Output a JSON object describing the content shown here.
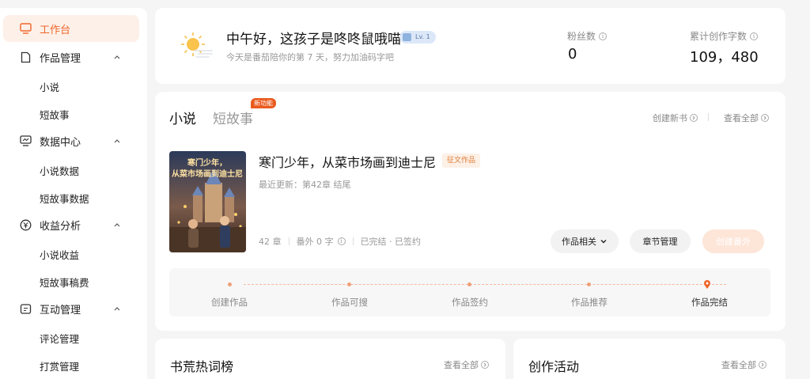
{
  "sidebar": {
    "workbench": "工作台",
    "groups": [
      {
        "label": "作品管理",
        "items": [
          "小说",
          "短故事"
        ]
      },
      {
        "label": "数据中心",
        "items": [
          "小说数据",
          "短故事数据"
        ]
      },
      {
        "label": "收益分析",
        "items": [
          "小说收益",
          "短故事稿费"
        ]
      },
      {
        "label": "互动管理",
        "items": [
          "评论管理",
          "打赏管理"
        ]
      }
    ]
  },
  "greeting": {
    "title": "中午好，这孩子是咚咚鼠哦喵",
    "level": "Lv. 1",
    "subtitle": "今天是番茄陪你的第 7 天，努力加油码字吧",
    "fans_label": "粉丝数",
    "fans_value": "0",
    "words_label": "累计创作字数",
    "words_value": "109，480"
  },
  "works": {
    "tabs": [
      "小说",
      "短故事"
    ],
    "new_badge": "新功能",
    "create_link": "创建新书",
    "view_all": "查看全部",
    "book": {
      "cover_text_line1": "寒门少年，",
      "cover_text_line2": "从菜市场画到迪士尼",
      "title": "寒门少年，从菜市场画到迪士尼",
      "tag": "征文作品",
      "update": "最近更新：第42章 结尾",
      "chapters": "42 章",
      "extra": "番外 0 字",
      "status": "已完结 · 已签约"
    },
    "buttons": {
      "related": "作品相关",
      "chapters": "章节管理",
      "create_extra": "创建番外"
    },
    "steps": [
      "创建作品",
      "作品可搜",
      "作品签约",
      "作品推荐",
      "作品完结"
    ],
    "accent": "#f0652a"
  },
  "hot": {
    "title": "书荒热词榜",
    "view_all": "查看全部"
  },
  "activity": {
    "title": "创作活动",
    "view_all": "查看全部"
  }
}
